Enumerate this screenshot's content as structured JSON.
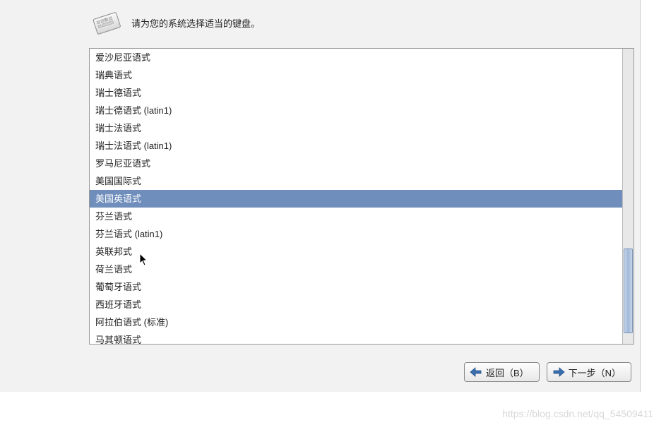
{
  "header": {
    "prompt": "请为您的系统选择适当的键盘。"
  },
  "keyboards": {
    "items": [
      {
        "label": "爱沙尼亚语式",
        "selected": false
      },
      {
        "label": "瑞典语式",
        "selected": false
      },
      {
        "label": "瑞士德语式",
        "selected": false
      },
      {
        "label": "瑞士德语式 (latin1)",
        "selected": false
      },
      {
        "label": "瑞士法语式",
        "selected": false
      },
      {
        "label": "瑞士法语式 (latin1)",
        "selected": false
      },
      {
        "label": "罗马尼亚语式",
        "selected": false
      },
      {
        "label": "美国国际式",
        "selected": false
      },
      {
        "label": "美国英语式",
        "selected": true
      },
      {
        "label": "芬兰语式",
        "selected": false
      },
      {
        "label": "芬兰语式 (latin1)",
        "selected": false
      },
      {
        "label": "英联邦式",
        "selected": false
      },
      {
        "label": "荷兰语式",
        "selected": false
      },
      {
        "label": "葡萄牙语式",
        "selected": false
      },
      {
        "label": "西班牙语式",
        "selected": false
      },
      {
        "label": "阿拉伯语式 (标准)",
        "selected": false
      },
      {
        "label": "马其顿语式",
        "selected": false
      }
    ]
  },
  "buttons": {
    "back": "返回（B）",
    "next": "下一步（N）"
  },
  "watermark": "https://blog.csdn.net/qq_54509411"
}
